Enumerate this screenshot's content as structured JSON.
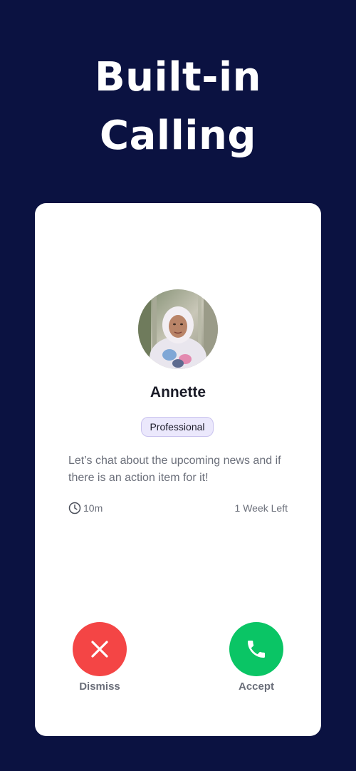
{
  "headline": {
    "line1": "Built-in",
    "line2": "Calling"
  },
  "caller": {
    "name": "Annette",
    "tag": "Professional",
    "message": "Let’s chat about the upcoming news and if there is an action item for it!",
    "duration": "10m",
    "time_left": "1 Week Left"
  },
  "actions": {
    "dismiss_label": "Dismiss",
    "accept_label": "Accept"
  },
  "colors": {
    "background": "#0b1241",
    "dismiss": "#f44545",
    "accept": "#0ac565",
    "badge_bg": "#ebe8fc"
  },
  "icons": {
    "clock": "clock-icon",
    "dismiss": "close-icon",
    "accept": "phone-icon"
  }
}
